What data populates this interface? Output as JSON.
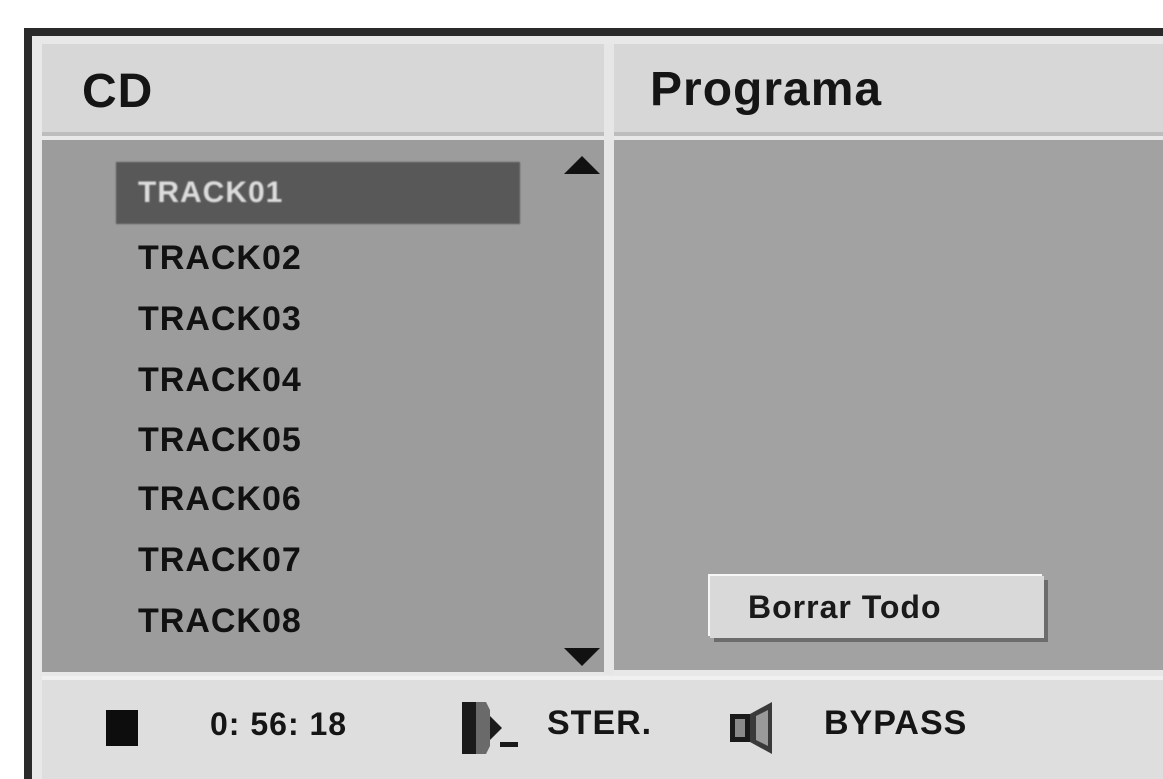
{
  "cd_panel": {
    "title": "CD",
    "tracks": [
      "TRACK01",
      "TRACK02",
      "TRACK03",
      "TRACK04",
      "TRACK05",
      "TRACK06",
      "TRACK07",
      "TRACK08"
    ],
    "selected_index": 0
  },
  "program_panel": {
    "title": "Programa",
    "clear_all_label": "Borrar Todo"
  },
  "status_bar": {
    "playback_state_icon": "stop-icon",
    "time": "0: 56: 18",
    "audio_mode": "STER.",
    "audio_mode_icon": "audio-channel-icon",
    "sound_effect": "BYPASS",
    "sound_effect_icon": "speaker-icon"
  }
}
